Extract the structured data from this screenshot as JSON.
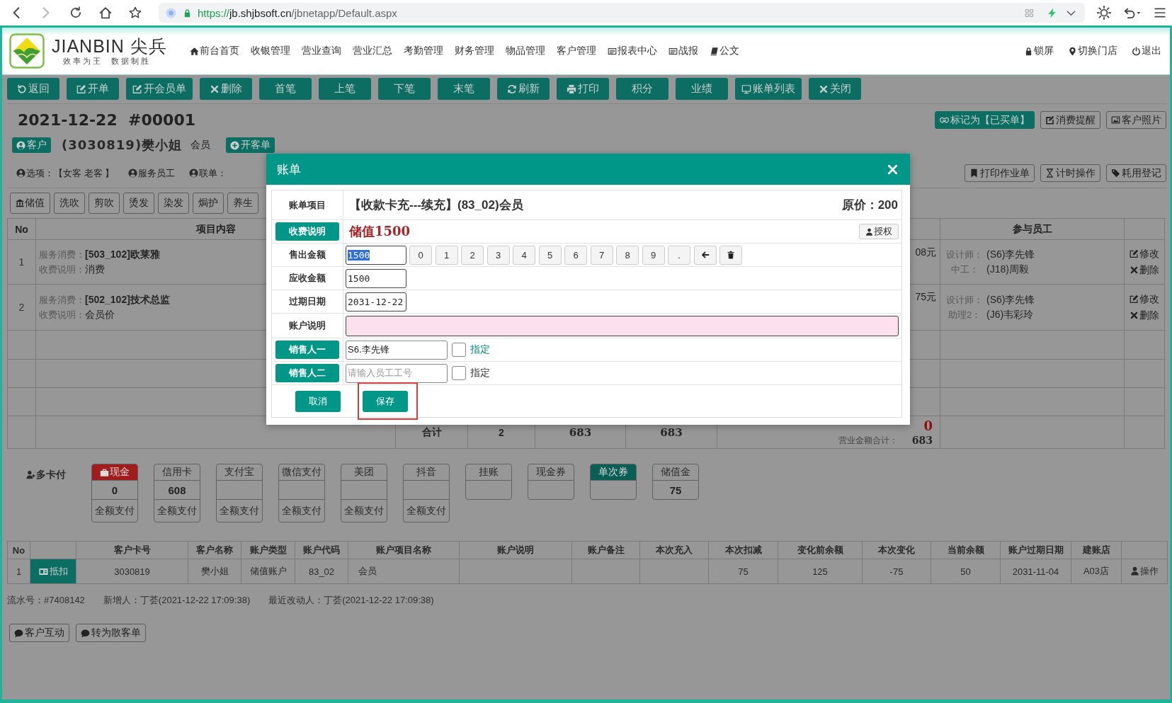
{
  "browser": {
    "url": {
      "scheme": "https://",
      "host": "jb.shjbsoft.cn",
      "path": "/jbnetapp/Default.aspx"
    }
  },
  "header": {
    "brand": "JIANBIN 尖兵",
    "slogan": "效率为王  数据制胜",
    "nav": [
      "前台首页",
      "收银管理",
      "营业查询",
      "营业汇总",
      "考勤管理",
      "财务管理",
      "物品管理",
      "客户管理",
      "报表中心",
      "战报",
      "公文"
    ],
    "user_links": [
      "锁屏",
      "切换门店",
      "退出"
    ]
  },
  "toolbar": [
    "返回",
    "开单",
    "开会员单",
    "删除",
    "首笔",
    "上笔",
    "下笔",
    "末笔",
    "刷新",
    "打印",
    "积分",
    "业绩",
    "账单列表",
    "关闭"
  ],
  "bill": {
    "title": "2021-12-22  #00001",
    "actions": [
      {
        "label": "标记为【已买单】",
        "primary": true
      },
      {
        "label": "消费提醒",
        "primary": false
      },
      {
        "label": "客户照片",
        "primary": false
      }
    ],
    "client": {
      "button": "客户",
      "name": "(3030819)樊小姐",
      "member_type": "会员",
      "open_button": "开客单"
    },
    "options": [
      "选项：【女客 老客 】",
      "服务员工",
      "联单："
    ],
    "tools": [
      "打印作业单",
      "计时操作",
      "耗用登记"
    ],
    "categories": [
      "储值",
      "洗吹",
      "剪吹",
      "烫发",
      "染发",
      "焗护",
      "养生"
    ]
  },
  "items_table": {
    "columns": [
      "No",
      "项目内容",
      "参与员工"
    ],
    "rows": [
      {
        "no": "1",
        "lines": [
          {
            "label": "服务消费：",
            "value": "[503_102]欧莱雅",
            "bold": true
          },
          {
            "label": "收费说明：",
            "value": "消费",
            "bold": false
          }
        ],
        "amount": "08元",
        "staff": [
          {
            "role": "设计师：",
            "name": "(S6)李先锋"
          },
          {
            "role": "中工：",
            "name": "(J18)周毅"
          }
        ],
        "actions": [
          "修改",
          "删除"
        ]
      },
      {
        "no": "2",
        "lines": [
          {
            "label": "服务消费：",
            "value": "[502_102]技术总监",
            "bold": true
          },
          {
            "label": "收费说明：",
            "value": "会员价",
            "bold": false
          }
        ],
        "amount": "75元",
        "staff": [
          {
            "role": "设计师：",
            "name": "(S6)李先锋"
          },
          {
            "role": "助理2：",
            "name": "(J6)韦彩玲"
          }
        ],
        "actions": [
          "修改",
          "删除"
        ]
      }
    ],
    "total": {
      "label": "合计",
      "count": "2",
      "amount": "683",
      "amount_2": "683",
      "unpaid": "0",
      "revenue_label": "营业金额合计：",
      "revenue": "683"
    }
  },
  "payment": {
    "label": "多卡付",
    "methods": [
      {
        "name": "现金",
        "amount": "0",
        "full_pay": "全额支付",
        "color": "#a11d1d"
      },
      {
        "name": "信用卡",
        "amount": "608",
        "full_pay": "全额支付"
      },
      {
        "name": "支付宝",
        "full_pay": "全额支付"
      },
      {
        "name": "微信支付",
        "full_pay": "全额支付"
      },
      {
        "name": "美团",
        "full_pay": "全额支付"
      },
      {
        "name": "抖音",
        "full_pay": "全额支付"
      },
      {
        "name": "挂账"
      },
      {
        "name": "现金券"
      },
      {
        "name": "单次券",
        "color": "#0b5e55"
      },
      {
        "name": "储值金",
        "amount": "75"
      }
    ]
  },
  "accounts_table": {
    "columns": [
      "No",
      "客户卡号",
      "客户名称",
      "账户类型",
      "账户代码",
      "账户项目名称",
      "账户说明",
      "账户备注",
      "本次充入",
      "本次扣减",
      "变化前余额",
      "本次变化",
      "当前余额",
      "账户过期日期",
      "建账店"
    ],
    "rows": [
      {
        "no": "1",
        "button": "抵扣",
        "card_no": "3030819",
        "name": "樊小姐",
        "account_type": "储值账户",
        "account_code": "83_02",
        "item_name": "会员",
        "deducted": "75",
        "balance_before": "125",
        "change": "-75",
        "balance": "50",
        "expiry": "2031-11-04",
        "store": "A03店",
        "action": "操作"
      }
    ]
  },
  "record": [
    "流水号：#7408142",
    "新增人：丁荟(2021-12-22 17:09:38)",
    "最近改动人：丁荟(2021-12-22 17:09:38)"
  ],
  "footer_buttons": [
    "客户互动",
    "转为散客单"
  ],
  "modal": {
    "title": "账单",
    "rows": [
      {
        "kind": "item",
        "label": "账单项目",
        "value": "【收款卡充---续充】(83_02)会员",
        "price": "原价：200"
      },
      {
        "kind": "note",
        "label": "收费说明",
        "value": "储值1500",
        "button": "授权"
      },
      {
        "kind": "keypad_input",
        "label": "售出金额",
        "value": "1500",
        "text_selected": true,
        "keys": [
          "0",
          "1",
          "2",
          "3",
          "4",
          "5",
          "6",
          "7",
          "8",
          "9",
          "."
        ]
      },
      {
        "kind": "input",
        "label": "应收金额",
        "value": "1500"
      },
      {
        "kind": "input",
        "label": "过期日期",
        "value": "2031-12-22"
      },
      {
        "kind": "wide_input",
        "label": "账户说明"
      },
      {
        "kind": "seller",
        "label": "销售人一",
        "value": "S6.李先锋",
        "checked": false,
        "assign": "指定",
        "assign_active": true
      },
      {
        "kind": "seller",
        "label": "销售人二",
        "placeholder": "请输入员工工号",
        "checked": false,
        "assign": "指定",
        "assign_active": false
      }
    ],
    "buttons": [
      {
        "label": "取消",
        "highlighted": false
      },
      {
        "label": "保存",
        "highlighted": true
      }
    ]
  }
}
